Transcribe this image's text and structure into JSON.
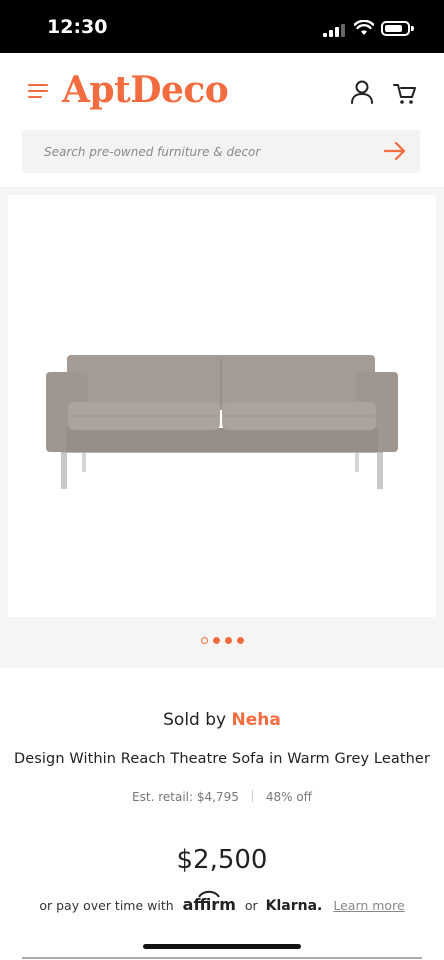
{
  "status_bar": {
    "time": "12:30"
  },
  "header": {
    "logo_text": "AptDeco"
  },
  "search": {
    "placeholder": "Search pre-owned furniture & decor",
    "value": ""
  },
  "gallery": {
    "image_alt": "Warm grey leather sofa",
    "slide_count": 4,
    "current_slide": 1
  },
  "product": {
    "sold_by_label": "Sold by ",
    "seller": "Neha",
    "title": "Design Within Reach Theatre Sofa in Warm Grey Leather",
    "est_retail": "Est. retail: $4,795",
    "discount": "48% off",
    "price": "$2,500"
  },
  "financing": {
    "prefix": "or pay over time with",
    "affirm": "affirm",
    "or": "or",
    "klarna": "Klarna.",
    "learn_more": "Learn more"
  },
  "colors": {
    "brand": "#f26c3f",
    "sofa": "#a39a94"
  },
  "icons": [
    "menu-icon",
    "user-icon",
    "cart-icon",
    "arrow-right-icon",
    "signal-icon",
    "wifi-icon",
    "battery-icon"
  ]
}
